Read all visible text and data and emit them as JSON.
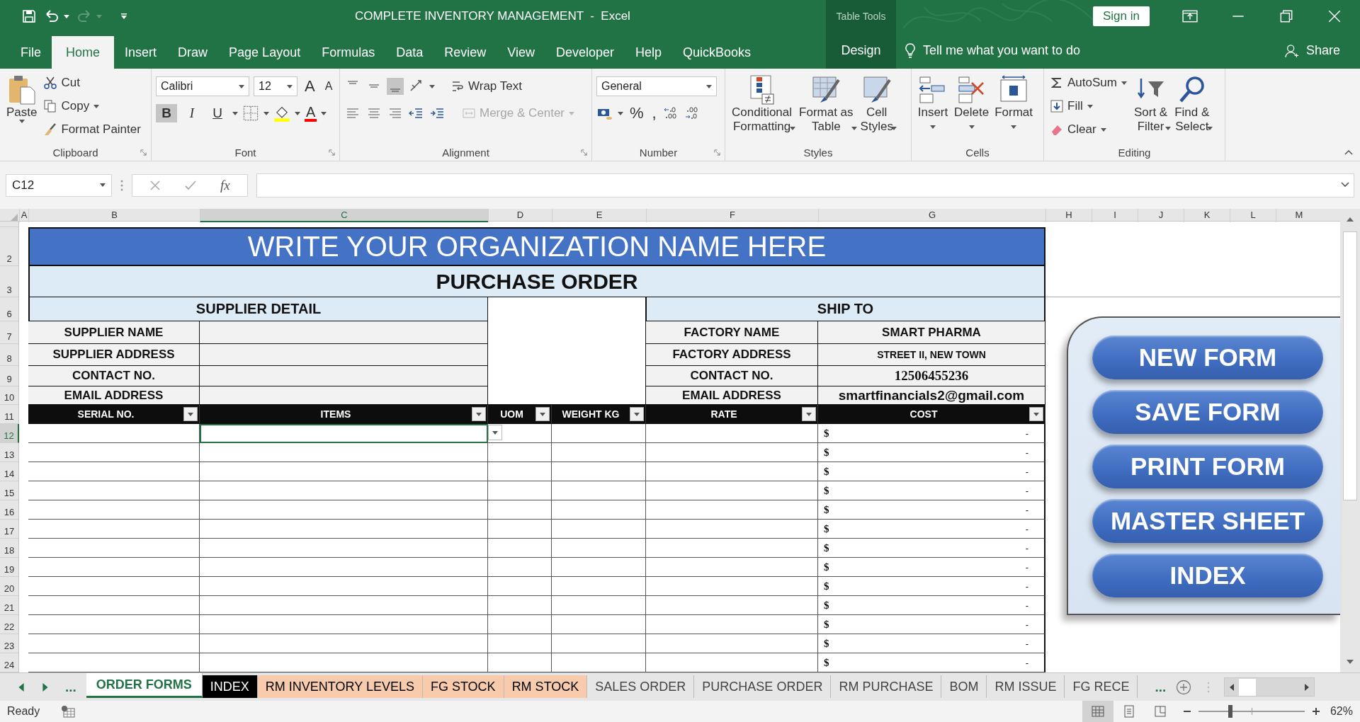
{
  "window": {
    "title": "COMPLETE INVENTORY MANAGEMENT  -  Excel",
    "context_group": "Table Tools",
    "sign_in": "Sign in"
  },
  "ribbon_tabs": [
    {
      "label": "File",
      "selected": false,
      "contextual": false
    },
    {
      "label": "Home",
      "selected": true,
      "contextual": false
    },
    {
      "label": "Insert",
      "selected": false,
      "contextual": false
    },
    {
      "label": "Draw",
      "selected": false,
      "contextual": false
    },
    {
      "label": "Page Layout",
      "selected": false,
      "contextual": false
    },
    {
      "label": "Formulas",
      "selected": false,
      "contextual": false
    },
    {
      "label": "Data",
      "selected": false,
      "contextual": false
    },
    {
      "label": "Review",
      "selected": false,
      "contextual": false
    },
    {
      "label": "View",
      "selected": false,
      "contextual": false
    },
    {
      "label": "Developer",
      "selected": false,
      "contextual": false
    },
    {
      "label": "Help",
      "selected": false,
      "contextual": false
    },
    {
      "label": "QuickBooks",
      "selected": false,
      "contextual": false
    },
    {
      "label": "Design",
      "selected": false,
      "contextual": true
    }
  ],
  "tell_me": "Tell me what you want to do",
  "share": "Share",
  "ribbon": {
    "clipboard": {
      "label": "Clipboard",
      "paste": "Paste",
      "cut": "Cut",
      "copy": "Copy",
      "format_painter": "Format Painter"
    },
    "font": {
      "label": "Font",
      "font_name": "Calibri",
      "font_size": "12",
      "grow": "A",
      "shrink": "A",
      "font_color": "A",
      "styles": [
        {
          "kind": "bold",
          "glyph": "B",
          "pressed": true
        },
        {
          "kind": "italic",
          "glyph": "I",
          "pressed": false
        },
        {
          "kind": "underline",
          "glyph": "U",
          "pressed": false
        }
      ]
    },
    "alignment": {
      "label": "Alignment",
      "wrap_text": "Wrap Text",
      "merge_center": "Merge & Center",
      "merge_disabled": true,
      "vertical": [
        {
          "kind": "top",
          "pressed": false
        },
        {
          "kind": "middle",
          "pressed": false
        },
        {
          "kind": "bottom",
          "pressed": true
        }
      ]
    },
    "number": {
      "label": "Number",
      "format": "General",
      "percent": "%",
      "comma": ","
    },
    "styles": {
      "label": "Styles",
      "buttons": [
        {
          "lines": [
            "Conditional",
            "Formatting"
          ],
          "kind": "conditional"
        },
        {
          "lines": [
            "Format as",
            "Table"
          ],
          "kind": "table"
        },
        {
          "lines": [
            "Cell",
            "Styles"
          ],
          "kind": "cell"
        }
      ]
    },
    "cells": {
      "label": "Cells",
      "buttons": [
        {
          "label": "Insert",
          "kind": "insert"
        },
        {
          "label": "Delete",
          "kind": "delete"
        },
        {
          "label": "Format",
          "kind": "format"
        }
      ]
    },
    "editing": {
      "label": "Editing",
      "autosum": "AutoSum",
      "fill": "Fill",
      "clear": "Clear",
      "sort": [
        "Sort &",
        "Filter"
      ],
      "find": [
        "Find &",
        "Select"
      ]
    }
  },
  "formula_bar": {
    "name_box": "C12",
    "fx": "fx"
  },
  "columns": [
    {
      "label": "A",
      "selected": false
    },
    {
      "label": "B",
      "selected": false
    },
    {
      "label": "C",
      "selected": true
    },
    {
      "label": "D",
      "selected": false
    },
    {
      "label": "E",
      "selected": false
    },
    {
      "label": "F",
      "selected": false
    },
    {
      "label": "G",
      "selected": false
    },
    {
      "label": "H",
      "selected": false
    },
    {
      "label": "I",
      "selected": false
    },
    {
      "label": "J",
      "selected": false
    },
    {
      "label": "K",
      "selected": false
    },
    {
      "label": "L",
      "selected": false
    },
    {
      "label": "M",
      "selected": false
    }
  ],
  "row_headers": [
    {
      "label": "2",
      "selected": false
    },
    {
      "label": "3",
      "selected": false
    },
    {
      "label": "6",
      "selected": false
    },
    {
      "label": "7",
      "selected": false
    },
    {
      "label": "8",
      "selected": false
    },
    {
      "label": "9",
      "selected": false
    },
    {
      "label": "10",
      "selected": false
    },
    {
      "label": "11",
      "selected": false
    },
    {
      "label": "12",
      "selected": true
    },
    {
      "label": "13",
      "selected": false
    },
    {
      "label": "14",
      "selected": false
    },
    {
      "label": "15",
      "selected": false
    },
    {
      "label": "16",
      "selected": false
    },
    {
      "label": "17",
      "selected": false
    },
    {
      "label": "18",
      "selected": false
    },
    {
      "label": "19",
      "selected": false
    },
    {
      "label": "20",
      "selected": false
    },
    {
      "label": "21",
      "selected": false
    },
    {
      "label": "22",
      "selected": false
    },
    {
      "label": "23",
      "selected": false
    },
    {
      "label": "24",
      "selected": false
    }
  ],
  "sheet": {
    "org_name": "WRITE YOUR ORGANIZATION NAME HERE",
    "form_title": "PURCHASE ORDER",
    "supplier": {
      "heading": "SUPPLIER DETAIL",
      "fields": [
        {
          "label": "SUPPLIER NAME"
        },
        {
          "label": "SUPPLIER ADDRESS"
        },
        {
          "label": "CONTACT NO."
        },
        {
          "label": "EMAIL ADDRESS"
        }
      ]
    },
    "ship_to": {
      "heading": "SHIP TO",
      "fields": [
        {
          "label": "FACTORY NAME",
          "value": "SMART PHARMA",
          "kind": "name"
        },
        {
          "label": "FACTORY ADDRESS",
          "value": "STREET II, NEW TOWN",
          "kind": "address"
        },
        {
          "label": "CONTACT NO.",
          "value": "12506455236",
          "kind": "phone"
        },
        {
          "label": "EMAIL ADDRESS",
          "value": "smartfinancials2@gmail.com",
          "kind": "email"
        }
      ]
    },
    "table_columns": [
      "SERIAL NO.",
      "ITEMS",
      "UOM",
      "WEIGHT KG",
      "RATE",
      "COST"
    ],
    "rows": [
      {
        "currency": "$",
        "cost": "-",
        "selected": true
      },
      {
        "currency": "$",
        "cost": "-",
        "selected": false
      },
      {
        "currency": "$",
        "cost": "-",
        "selected": false
      },
      {
        "currency": "$",
        "cost": "-",
        "selected": false
      },
      {
        "currency": "$",
        "cost": "-",
        "selected": false
      },
      {
        "currency": "$",
        "cost": "-",
        "selected": false
      },
      {
        "currency": "$",
        "cost": "-",
        "selected": false
      },
      {
        "currency": "$",
        "cost": "-",
        "selected": false
      },
      {
        "currency": "$",
        "cost": "-",
        "selected": false
      },
      {
        "currency": "$",
        "cost": "-",
        "selected": false
      },
      {
        "currency": "$",
        "cost": "-",
        "selected": false
      },
      {
        "currency": "$",
        "cost": "-",
        "selected": false
      },
      {
        "currency": "$",
        "cost": "-",
        "selected": false
      }
    ],
    "panel_buttons": [
      "NEW FORM",
      "SAVE FORM",
      "PRINT FORM",
      "MASTER SHEET",
      "INDEX"
    ]
  },
  "sheet_tabs": [
    {
      "label": "ORDER FORMS",
      "selected": true
    },
    {
      "label": "INDEX",
      "selected": false,
      "color": "#000000"
    },
    {
      "label": "RM INVENTORY LEVELS",
      "selected": false,
      "color": "#f8cbad"
    },
    {
      "label": "FG STOCK",
      "selected": false,
      "color": "#f8cbad"
    },
    {
      "label": "RM STOCK",
      "selected": false,
      "color": "#f8cbad"
    },
    {
      "label": "SALES ORDER",
      "selected": false
    },
    {
      "label": "PURCHASE ORDER",
      "selected": false
    },
    {
      "label": "RM PURCHASE",
      "selected": false
    },
    {
      "label": "BOM",
      "selected": false
    },
    {
      "label": "RM ISSUE",
      "selected": false
    },
    {
      "label": "FG RECE",
      "selected": false
    }
  ],
  "tabs_more": "...",
  "tabs_more_right": "...",
  "status_bar": {
    "status": "Ready",
    "views": [
      {
        "kind": "normal",
        "selected": true
      },
      {
        "kind": "page_layout",
        "selected": false
      },
      {
        "kind": "page_break",
        "selected": false
      }
    ],
    "level": 0.3,
    "zoom": "62%"
  }
}
